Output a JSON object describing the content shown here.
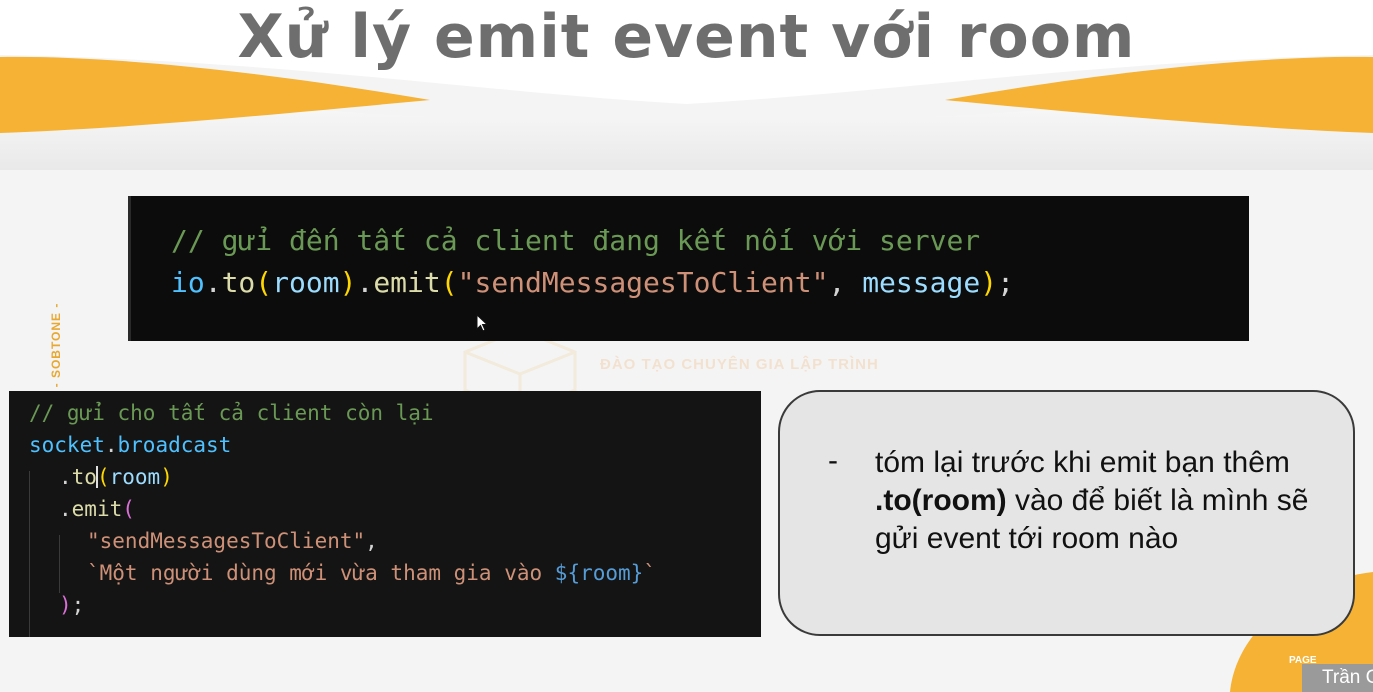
{
  "slide": {
    "title": "Xử lý emit event với room",
    "side_label": "- SOBTONE -",
    "watermark_text": "ĐÀO TẠO CHUYÊN GIA LẬP TRÌNH",
    "page_label": "PAGE",
    "presenter_name": "Trần C",
    "colors": {
      "accent_orange": "#f5b234",
      "title_gray": "#6e6e6e",
      "code_background": "#0c0c0c",
      "note_background": "#e5e5e5"
    }
  },
  "code_top": {
    "comment": "// gửi đến tất cả client đang kết nối với server",
    "line2": {
      "io": "io",
      "dot1": ".",
      "to": "to",
      "paren_open1": "(",
      "room": "room",
      "paren_close1": ")",
      "dot2": ".",
      "emit": "emit",
      "paren_open2": "(",
      "event_string": "\"sendMessagesToClient\"",
      "comma": ", ",
      "message": "message",
      "paren_close2": ")",
      "semicolon": ";"
    }
  },
  "code_bottom": {
    "comment": "// gửi cho tất cả client còn lại",
    "socket": "socket",
    "dot": ".",
    "broadcast": "broadcast",
    "to_dot": ".",
    "to_fn": "to",
    "to_open": "(",
    "to_arg": "room",
    "to_close": ")",
    "emit_dot": ".",
    "emit_fn": "emit",
    "emit_open": "(",
    "event_string": "\"sendMessagesToClient\"",
    "event_comma": ",",
    "template_start": "`Một người dùng mới vừa tham gia vào ",
    "template_expr": "${room}",
    "template_end": "`",
    "close_paren": ")",
    "close_semicolon": ";"
  },
  "note": {
    "bullet": "-",
    "text_before": "tóm lại trước khi emit bạn thêm ",
    "text_bold": ".to(room)",
    "text_after": " vào để biết là mình sẽ gửi event tới room nào"
  },
  "icons": {
    "mouse_pointer": "mouse-pointer-icon",
    "text_caret": "text-caret"
  }
}
